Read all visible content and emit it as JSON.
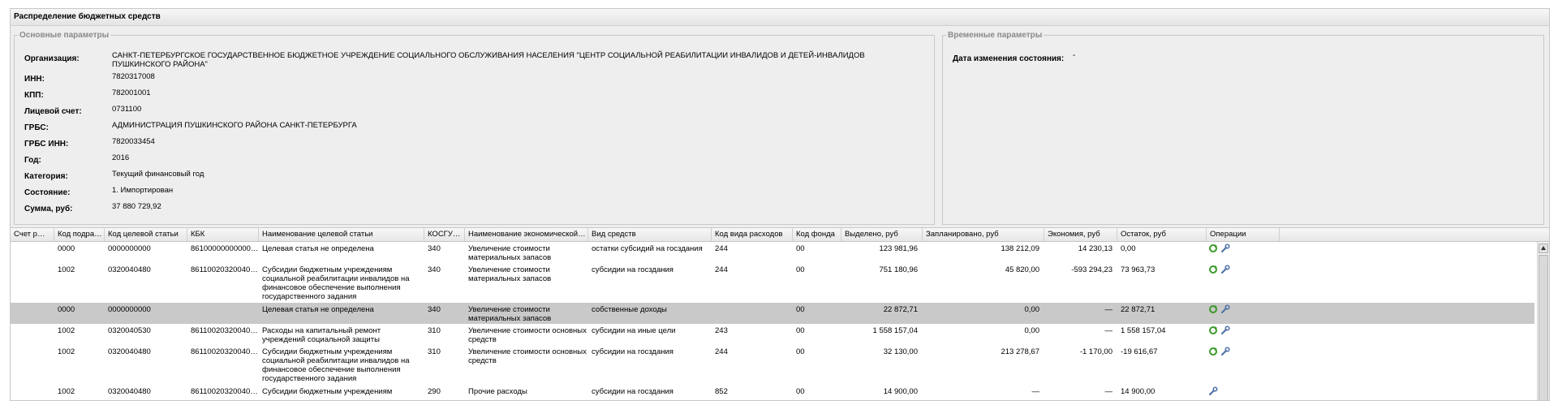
{
  "panel": {
    "title": "Распределение бюджетных средств"
  },
  "main_params": {
    "legend": "Основные параметры",
    "fields": [
      {
        "label": "Организация:",
        "value": "САНКТ-ПЕТЕРБУРГСКОЕ ГОСУДАРСТВЕННОЕ БЮДЖЕТНОЕ УЧРЕЖДЕНИЕ СОЦИАЛЬНОГО ОБСЛУЖИВАНИЯ НАСЕЛЕНИЯ \"ЦЕНТР СОЦИАЛЬНОЙ РЕАБИЛИТАЦИИ ИНВАЛИДОВ И ДЕТЕЙ-ИНВАЛИДОВ ПУШКИНСКОГО РАЙОНА\""
      },
      {
        "label": "ИНН:",
        "value": "7820317008"
      },
      {
        "label": "КПП:",
        "value": "782001001"
      },
      {
        "label": "Лицевой счет:",
        "value": "0731100"
      },
      {
        "label": "ГРБС:",
        "value": "АДМИНИСТРАЦИЯ ПУШКИНСКОГО РАЙОНА САНКТ-ПЕТЕРБУРГА"
      },
      {
        "label": "ГРБС ИНН:",
        "value": "7820033454"
      },
      {
        "label": "Год:",
        "value": "2016"
      },
      {
        "label": "Категория:",
        "value": "Текущий финансовый год"
      },
      {
        "label": "Состояние:",
        "value": "1. Импортирован"
      },
      {
        "label": "Сумма, руб:",
        "value": "37 880 729,92"
      }
    ]
  },
  "time_params": {
    "legend": "Временные параметры",
    "label": "Дата изменения состояния:",
    "value": "-"
  },
  "grid": {
    "columns": [
      "Счет р…",
      "Код подра…",
      "Код целевой статьи",
      "КБК",
      "Наименование целевой статьи",
      "КОСГУ…",
      "Наименование экономической …",
      "Вид средств",
      "Код вида расходов",
      "Код фонда",
      "Выделено, руб",
      "Запланировано, руб",
      "Экономия, руб",
      "Остаток, руб",
      "Операции"
    ],
    "rows": [
      {
        "podr": "0000",
        "cel": "0000000000",
        "kbk": "86100000000000…",
        "name": "Целевая статья не определена",
        "kosgu": "340",
        "econ": "Увеличение стоимости материальных запасов",
        "vid": "остатки субсидий на госздания",
        "kvr": "244",
        "fond": "00",
        "vydel": "123 981,96",
        "plan": "138 212,09",
        "econ_sum": "14 230,13",
        "ostatok": "0,00",
        "ops": 2
      },
      {
        "podr": "1002",
        "cel": "0320040480",
        "kbk": "86110020320040…",
        "name": "Субсидии бюджетным учреждениям социальной реабилитации инвалидов на финансовое обеспечение выполнения государственного задания",
        "kosgu": "340",
        "econ": "Увеличение стоимости материальных запасов",
        "vid": "субсидии на госздания",
        "kvr": "244",
        "fond": "00",
        "vydel": "751 180,96",
        "plan": "45 820,00",
        "econ_sum": "-593 294,23",
        "ostatok": "73 963,73",
        "ops": 2
      },
      {
        "podr": "0000",
        "cel": "0000000000",
        "kbk": "",
        "name": "Целевая статья не определена",
        "kosgu": "340",
        "econ": "Увеличение стоимости материальных запасов",
        "vid": "собственные доходы",
        "kvr": "",
        "fond": "00",
        "vydel": "22 872,71",
        "plan": "0,00",
        "econ_sum": "—",
        "ostatok": "22 872,71",
        "ops": 2,
        "selected": true
      },
      {
        "podr": "1002",
        "cel": "0320040530",
        "kbk": "86110020320040…",
        "name": "Расходы на капитальный ремонт учреждений социальной защиты",
        "kosgu": "310",
        "econ": "Увеличение стоимости основных средств",
        "vid": "субсидии на иные цели",
        "kvr": "243",
        "fond": "00",
        "vydel": "1 558 157,04",
        "plan": "0,00",
        "econ_sum": "—",
        "ostatok": "1 558 157,04",
        "ops": 2
      },
      {
        "podr": "1002",
        "cel": "0320040480",
        "kbk": "86110020320040…",
        "name": "Субсидии бюджетным учреждениям социальной реабилитации инвалидов на финансовое обеспечение выполнения государственного задания",
        "kosgu": "310",
        "econ": "Увеличение стоимости основных средств",
        "vid": "субсидии на госздания",
        "kvr": "244",
        "fond": "00",
        "vydel": "32 130,00",
        "plan": "213 278,67",
        "econ_sum": "-1 170,00",
        "ostatok": "-19 616,67",
        "ops": 2
      },
      {
        "podr": "1002",
        "cel": "0320040480",
        "kbk": "86110020320040…",
        "name": "Субсидии бюджетным учреждениям",
        "kosgu": "290",
        "econ": "Прочие расходы",
        "vid": "субсидии на госздания",
        "kvr": "852",
        "fond": "00",
        "vydel": "14 900,00",
        "plan": "—",
        "econ_sum": "—",
        "ostatok": "14 900,00",
        "ops": 1
      }
    ]
  },
  "colors": {
    "panel_bg": "#eeeeee",
    "selected_row": "#c9c9c9",
    "icon_green": "#3c9a2a",
    "icon_blue": "#4a6fa5"
  },
  "icons": {
    "refresh": "refresh-icon",
    "edit": "wrench-icon"
  }
}
